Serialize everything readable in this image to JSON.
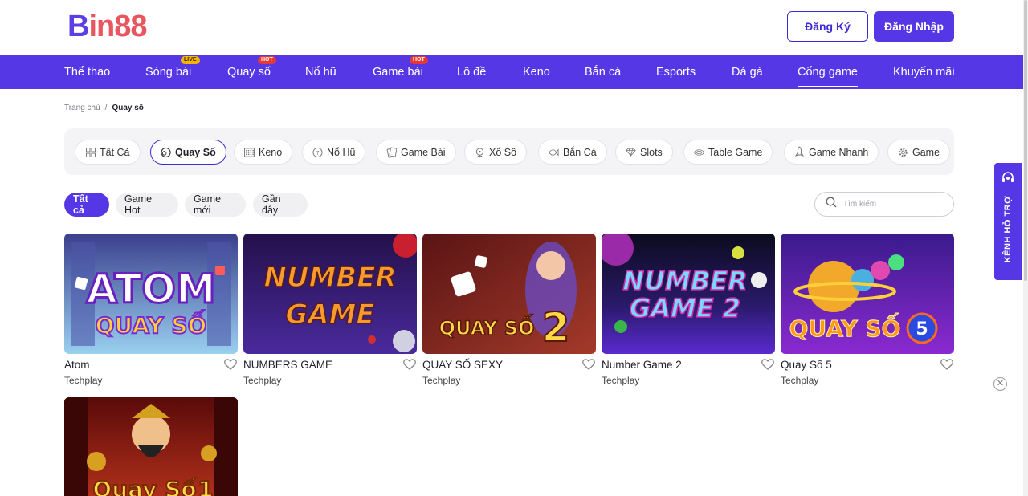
{
  "header": {
    "logo_b": "B",
    "logo_rest": "in88",
    "register_label": "Đăng Ký",
    "login_label": "Đăng Nhập"
  },
  "nav": {
    "items": [
      {
        "label": "Thể thao",
        "badge": ""
      },
      {
        "label": "Sòng bài",
        "badge": "LIVE"
      },
      {
        "label": "Quay số",
        "badge": "HOT"
      },
      {
        "label": "Nổ hũ",
        "badge": ""
      },
      {
        "label": "Game bài",
        "badge": "HOT"
      },
      {
        "label": "Lô đề",
        "badge": ""
      },
      {
        "label": "Keno",
        "badge": ""
      },
      {
        "label": "Bắn cá",
        "badge": ""
      },
      {
        "label": "Esports",
        "badge": ""
      },
      {
        "label": "Đá gà",
        "badge": ""
      },
      {
        "label": "Cổng game",
        "badge": "",
        "active": true
      },
      {
        "label": "Khuyến mãi",
        "badge": ""
      }
    ]
  },
  "breadcrumb": {
    "home": "Trang chủ",
    "separator": "/",
    "current": "Quay số"
  },
  "categories": [
    {
      "label": "Tất Cả",
      "icon": "grid-icon"
    },
    {
      "label": "Quay Số",
      "icon": "lottery-ball-icon",
      "active": true
    },
    {
      "label": "Keno",
      "icon": "keno-board-icon"
    },
    {
      "label": "Nổ Hũ",
      "icon": "jackpot-icon"
    },
    {
      "label": "Game Bài",
      "icon": "cards-icon"
    },
    {
      "label": "Xổ Số",
      "icon": "lottery-wheel-icon"
    },
    {
      "label": "Bắn Cá",
      "icon": "fish-icon"
    },
    {
      "label": "Slots",
      "icon": "diamond-icon"
    },
    {
      "label": "Table Game",
      "icon": "table-icon"
    },
    {
      "label": "Game Nhanh",
      "icon": "rocket-icon"
    },
    {
      "label": "Game",
      "icon": "gear-icon"
    }
  ],
  "filters": [
    {
      "label": "Tất cả",
      "active": true
    },
    {
      "label": "Game Hot"
    },
    {
      "label": "Game mới"
    },
    {
      "label": "Gần đây"
    }
  ],
  "search": {
    "placeholder": "Tìm kiếm",
    "value": ""
  },
  "games": [
    {
      "name": "Atom",
      "provider": "Techplay",
      "art_line1": "ATOM",
      "art_line2": "QUAY SỐ"
    },
    {
      "name": "NUMBERS GAME",
      "provider": "Techplay",
      "art_line1": "NUMBER",
      "art_line2": "GAME"
    },
    {
      "name": "QUAY SỐ SEXY",
      "provider": "Techplay",
      "art_line1": "QUAY SỐ",
      "art_line2": "2"
    },
    {
      "name": "Number Game 2",
      "provider": "Techplay",
      "art_line1": "NUMBER",
      "art_line2": "GAME 2"
    },
    {
      "name": "Quay Số 5",
      "provider": "Techplay",
      "art_line1": "QUAY SỐ",
      "art_line2": "5"
    },
    {
      "name": "",
      "provider": "",
      "art_line1": "Quay Số",
      "art_line2": "1"
    }
  ],
  "support": {
    "label": "KÊNH HỖ TRỢ"
  },
  "colors": {
    "brand": "#5637e6",
    "logo_red": "#e8565f",
    "hot_badge": "#e53935",
    "live_badge": "#f4b400"
  }
}
